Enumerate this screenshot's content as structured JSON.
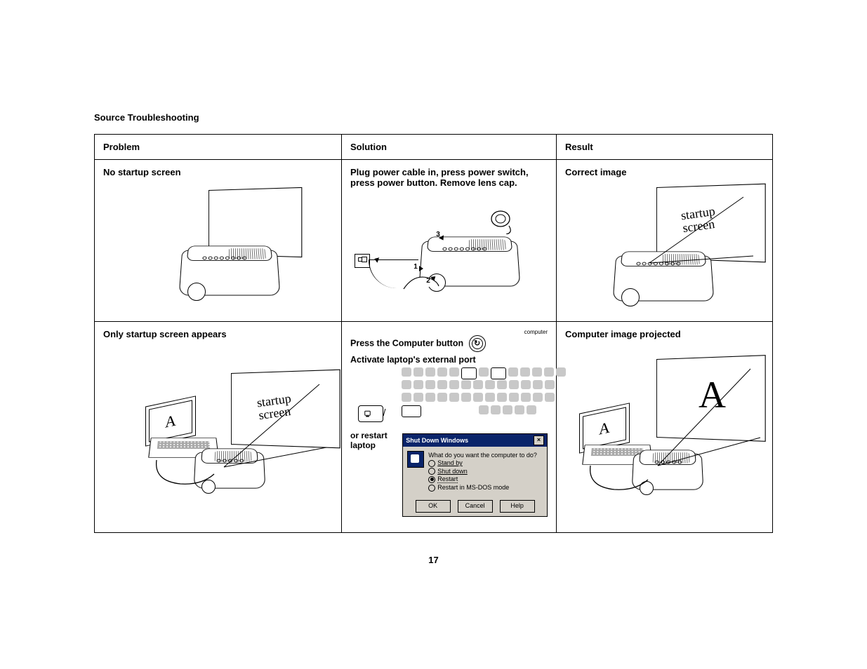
{
  "section_title": "Source Troubleshooting",
  "headers": {
    "problem": "Problem",
    "solution": "Solution",
    "result": "Result"
  },
  "row1": {
    "problem": "No startup screen",
    "solution": "Plug power cable in, press power switch, press power button. Remove lens cap.",
    "steps": {
      "s1": "1",
      "s2": "2",
      "s3": "3"
    },
    "result": "Correct image",
    "screen_tag": "startup\nscreen"
  },
  "row2": {
    "problem": "Only startup screen appears",
    "screen_tag": "startup\nscreen",
    "laptop_letter_problem": "A",
    "sol_line1": "Press the Computer button",
    "sol_btn_label": "computer",
    "sol_line2": "Activate laptop's external port",
    "sol_or": "or restart laptop",
    "dialog": {
      "title": "Shut Down Windows",
      "prompt": "What do you want the computer to do?",
      "opt1": "Stand by",
      "opt2": "Shut down",
      "opt3": "Restart",
      "opt4": "Restart in MS-DOS mode",
      "ok": "OK",
      "cancel": "Cancel",
      "help": "Help"
    },
    "result": "Computer image projected",
    "laptop_letter_result": "A",
    "projected_letter": "A"
  },
  "page_number": "17"
}
